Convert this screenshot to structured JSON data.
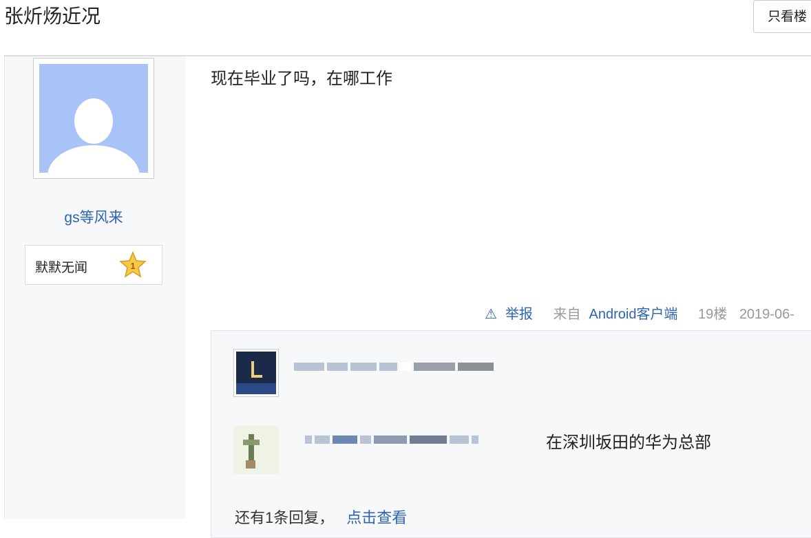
{
  "header": {
    "title": "张炘炀近况",
    "only_button": "只看楼"
  },
  "author": {
    "name": "gs等风来",
    "level_title": "默默无闻",
    "level_number": "1"
  },
  "post": {
    "content": "现在毕业了吗，在哪工作"
  },
  "meta": {
    "report_icon": "⚠",
    "report": "举报",
    "from_prefix": "来自",
    "client": "Android客户端",
    "floor": "19楼",
    "date": "2019-06-"
  },
  "comments": [
    {
      "text": ""
    },
    {
      "text": "在深圳坂田的华为总部"
    }
  ],
  "more_replies": {
    "text": "还有1条回复，",
    "link": "点击查看"
  },
  "colors": {
    "link": "#2d64b3",
    "sidebar_bg": "#f7f8fa",
    "avatar_bg": "#a9c2f8"
  }
}
